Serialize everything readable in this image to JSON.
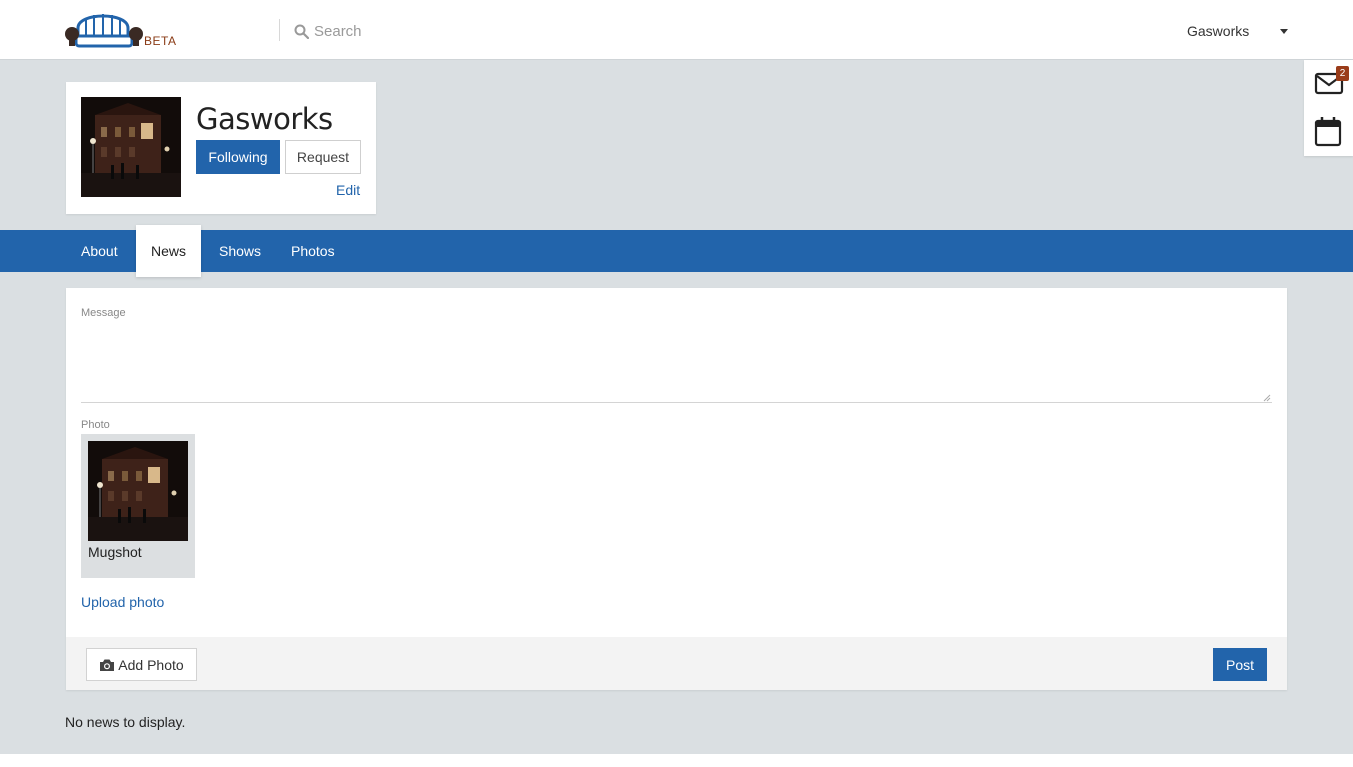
{
  "header": {
    "logo_badge": "BETA",
    "search_placeholder": "Search",
    "user_name": "Gasworks"
  },
  "dock": {
    "messages_badge": "2",
    "icons": [
      "envelope-icon",
      "calendar-icon"
    ]
  },
  "profile": {
    "name": "Gasworks",
    "following_label": "Following",
    "request_label": "Request",
    "edit_label": "Edit"
  },
  "tabs": [
    {
      "label": "About",
      "active": false
    },
    {
      "label": "News",
      "active": true
    },
    {
      "label": "Shows",
      "active": false
    },
    {
      "label": "Photos",
      "active": false
    }
  ],
  "composer": {
    "message_label": "Message",
    "message_value": "",
    "photo_label": "Photo",
    "photo_caption": "Mugshot",
    "upload_label": "Upload photo",
    "add_photo_label": "Add Photo",
    "post_label": "Post"
  },
  "news": {
    "empty_text": "No news to display."
  },
  "colors": {
    "brand_blue": "#2264ab",
    "background": "#dadfe2",
    "badge": "#9a3c19"
  }
}
